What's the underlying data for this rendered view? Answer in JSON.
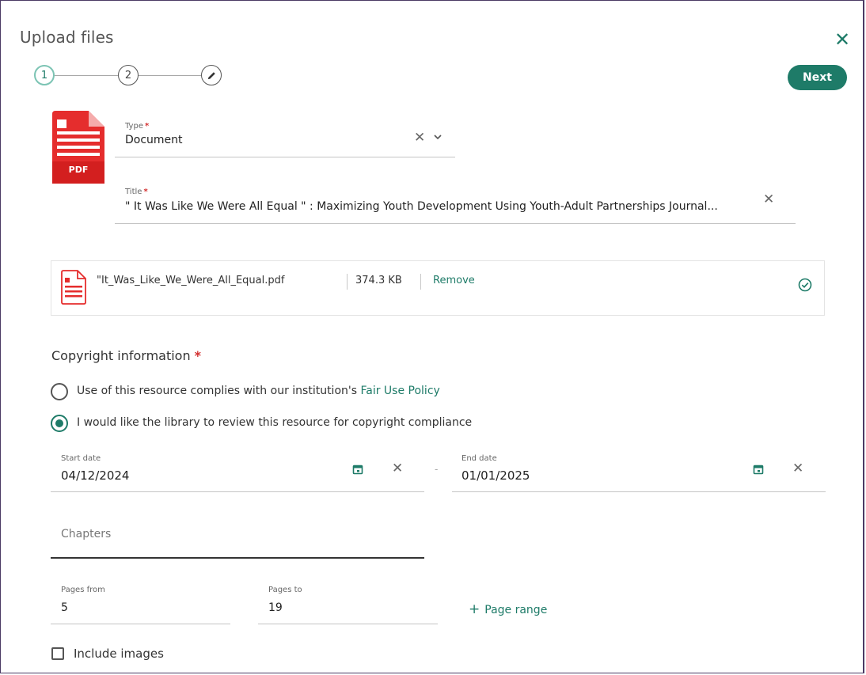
{
  "dialog": {
    "title": "Upload files",
    "next_label": "Next"
  },
  "stepper": {
    "steps": [
      "1",
      "2"
    ],
    "edit_icon": "pencil-icon"
  },
  "form": {
    "type": {
      "label": "Type",
      "value": "Document"
    },
    "title": {
      "label": "Title",
      "value": "\" It Was Like We Were All Equal \" : Maximizing Youth Development Using Youth-Adult Partnerships Journal..."
    },
    "pdf_badge": "PDF"
  },
  "file": {
    "name": "\"It_Was_Like_We_Were_All_Equal.pdf",
    "size": "374.3 KB",
    "remove_label": "Remove",
    "status_icon": "check-circle-icon"
  },
  "copyright": {
    "title": "Copyright information",
    "option1_text": "Use of this resource complies with our institution's ",
    "option1_link": "Fair Use Policy",
    "option2_text": "I would like the library to review this resource for copyright compliance",
    "selected_option": 2
  },
  "dates": {
    "start_label": "Start date",
    "start_value": "04/12/2024",
    "separator": "-",
    "end_label": "End date",
    "end_value": "01/01/2025"
  },
  "chapters": {
    "placeholder": "Chapters"
  },
  "pages": {
    "from_label": "Pages from",
    "from_value": "5",
    "to_label": "Pages to",
    "to_value": "19",
    "add_range_label": "Page range"
  },
  "include_images": {
    "label": "Include images",
    "checked": false
  },
  "colors": {
    "accent": "#1e7b68",
    "required": "#d32f2f",
    "pdf_red": "#e52d2d"
  }
}
